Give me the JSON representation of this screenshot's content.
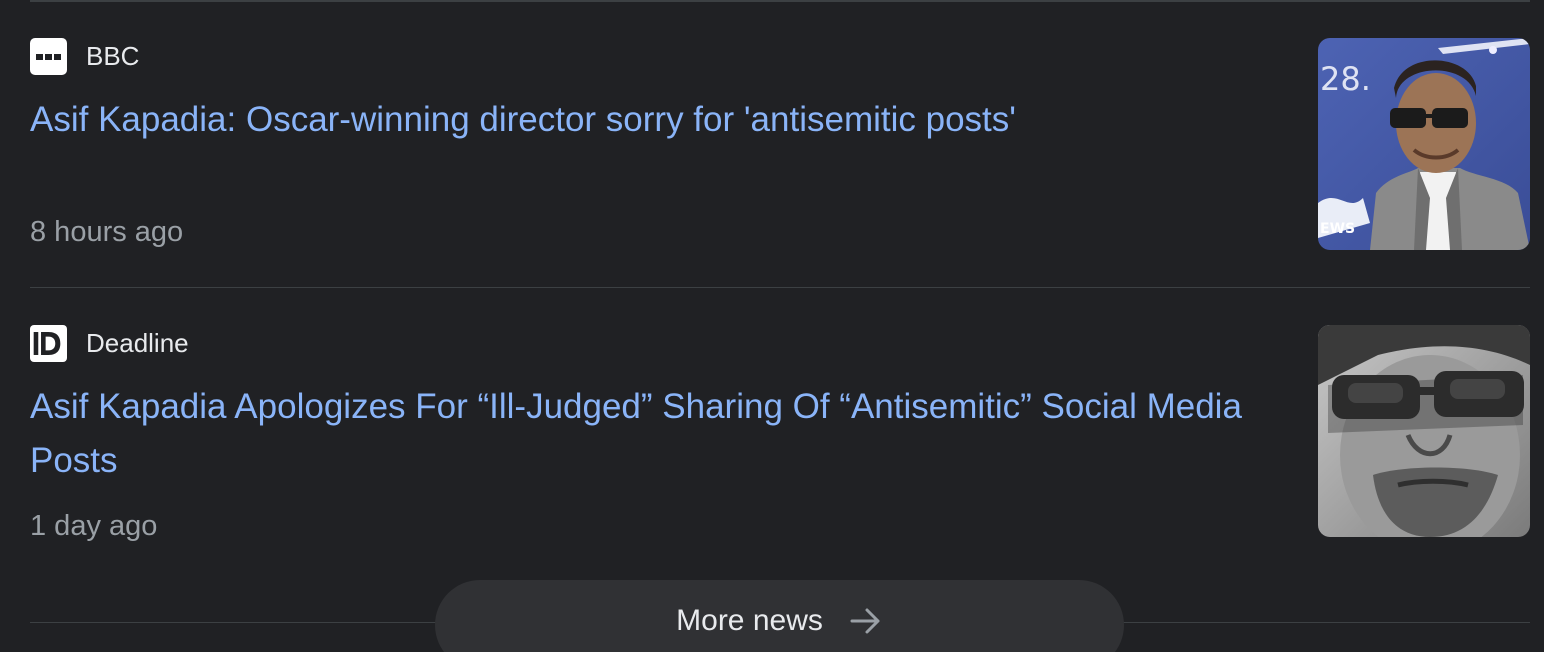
{
  "articles": [
    {
      "source": "BBC",
      "source_logo_icon": "bbc-logo-icon",
      "headline": "Asif Kapadia: Oscar-winning director sorry for 'antisemitic posts'",
      "time": "8 hours ago",
      "thumbnail_icon": "director-photo-thumbnail"
    },
    {
      "source": "Deadline",
      "source_logo_icon": "deadline-logo-icon",
      "headline": "Asif Kapadia Apologizes For “Ill-Judged” Sharing Of “Antisemitic” Social Media Posts",
      "time": "1 day ago",
      "thumbnail_icon": "director-bw-photo-thumbnail"
    }
  ],
  "more_news": {
    "label": "More news",
    "icon": "arrow-right-icon"
  },
  "colors": {
    "background": "#202124",
    "headline_link": "#8ab4f8",
    "source_text": "#e8eaed",
    "timestamp_text": "#9aa0a6",
    "divider": "#3c4043",
    "button_background": "#303134"
  }
}
